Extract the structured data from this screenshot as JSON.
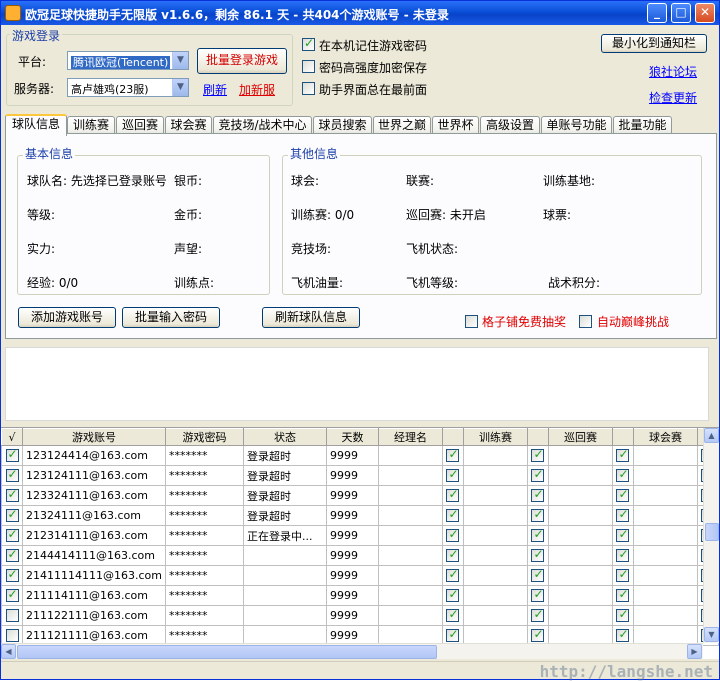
{
  "window": {
    "title": "欧冠足球快捷助手无限版 v1.6.6，剩余 86.1 天 - 共404个游戏账号 - 未登录",
    "minimize": "_",
    "maximize": "□",
    "close": "✕"
  },
  "login": {
    "group_label": "游戏登录",
    "platform_label": "平台:",
    "platform_value": "腾讯欧冠(Tencent)",
    "server_label": "服务器:",
    "server_value": "高卢雄鸡(23服)",
    "batch_login_button": "批量登录游戏",
    "refresh_link": "刷新",
    "add_server_link": "加新服"
  },
  "options": {
    "remember_password": {
      "label": "在本机记住游戏密码",
      "checked": true
    },
    "encrypt_password": {
      "label": "密码高强度加密保存",
      "checked": false
    },
    "always_on_top": {
      "label": "助手界面总在最前面",
      "checked": false
    }
  },
  "right_actions": {
    "minimize_tray_button": "最小化到通知栏",
    "forum_link": "狼社论坛",
    "update_link": "检查更新"
  },
  "tabs": [
    {
      "label": "球队信息",
      "active": true
    },
    {
      "label": "训练赛",
      "active": false
    },
    {
      "label": "巡回赛",
      "active": false
    },
    {
      "label": "球会赛",
      "active": false
    },
    {
      "label": "竞技场/战术中心",
      "active": false
    },
    {
      "label": "球员搜索",
      "active": false
    },
    {
      "label": "世界之巅",
      "active": false
    },
    {
      "label": "世界杯",
      "active": false
    },
    {
      "label": "高级设置",
      "active": false
    },
    {
      "label": "单账号功能",
      "active": false
    },
    {
      "label": "批量功能",
      "active": false
    }
  ],
  "basic_info": {
    "label": "基本信息",
    "team_name": "球队名: 先选择已登录账号",
    "silver": "银币:",
    "level": "等级:",
    "gold": "金币:",
    "strength": "实力:",
    "prestige": "声望:",
    "experience": "经验: 0/0",
    "training_points": "训练点:"
  },
  "other_info": {
    "label": "其他信息",
    "club": "球会:",
    "league": "联赛:",
    "training_base": "训练基地:",
    "training_match": "训练赛: 0/0",
    "tour_match": "巡回赛: 未开启",
    "tickets": "球票:",
    "arena": "竞技场:",
    "plane_status": "飞机状态:",
    "plane_fuel": "飞机油量:",
    "plane_level": "飞机等级:",
    "tactic_points": "战术积分:"
  },
  "panel_actions": {
    "add_account_button": "添加游戏账号",
    "batch_password_button": "批量输入密码",
    "refresh_team_button": "刷新球队信息",
    "free_lottery": {
      "label": "格子铺免费抽奖",
      "checked": false
    },
    "auto_peak": {
      "label": "自动巅峰挑战",
      "checked": false
    }
  },
  "grid": {
    "columns": [
      "√",
      "游戏账号",
      "游戏密码",
      "状态",
      "天数",
      "经理名",
      "",
      "训练赛",
      "",
      "巡回赛",
      "",
      "球会赛",
      ""
    ],
    "rows": [
      {
        "checked": true,
        "account": "123124414@163.com",
        "password": "*******",
        "status": "登录超时",
        "days": "9999",
        "manager": ""
      },
      {
        "checked": true,
        "account": "123124111@163.com",
        "password": "*******",
        "status": "登录超时",
        "days": "9999",
        "manager": ""
      },
      {
        "checked": true,
        "account": "123324111@163.com",
        "password": "*******",
        "status": "登录超时",
        "days": "9999",
        "manager": ""
      },
      {
        "checked": true,
        "account": "21324111@163.com",
        "password": "*******",
        "status": "登录超时",
        "days": "9999",
        "manager": ""
      },
      {
        "checked": true,
        "account": "212314111@163.com",
        "password": "*******",
        "status": "正在登录中...",
        "days": "9999",
        "manager": ""
      },
      {
        "checked": true,
        "account": "2144414111@163.com",
        "password": "*******",
        "status": "",
        "days": "9999",
        "manager": ""
      },
      {
        "checked": true,
        "account": "21411114111@163.com",
        "password": "*******",
        "status": "",
        "days": "9999",
        "manager": ""
      },
      {
        "checked": true,
        "account": "211114111@163.com",
        "password": "*******",
        "status": "",
        "days": "9999",
        "manager": ""
      },
      {
        "checked": false,
        "account": "211122111@163.com",
        "password": "*******",
        "status": "",
        "days": "9999",
        "manager": ""
      },
      {
        "checked": false,
        "account": "211121111@163.com",
        "password": "*******",
        "status": "",
        "days": "9999",
        "manager": ""
      }
    ]
  },
  "watermark": "http://langshe.net"
}
